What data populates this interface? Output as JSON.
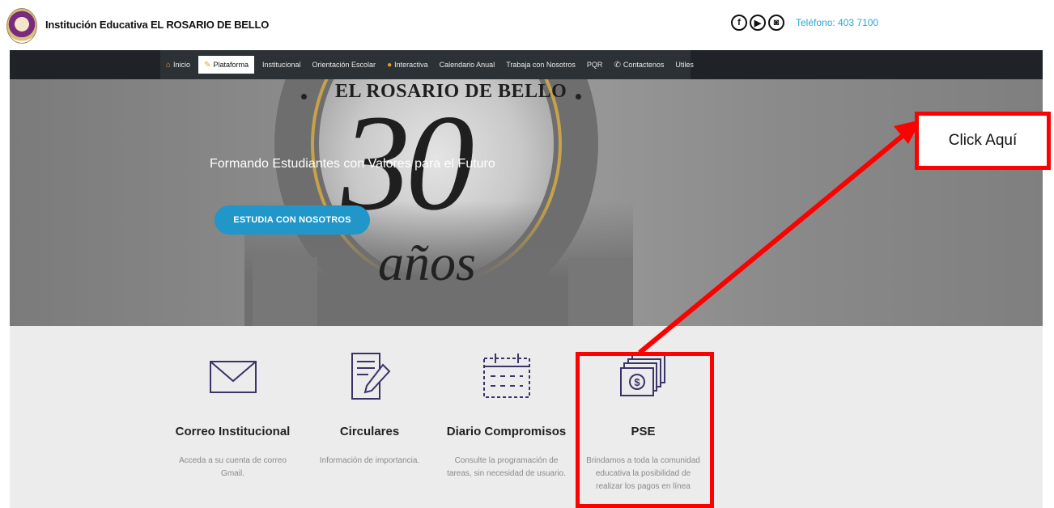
{
  "header": {
    "site_title": "Institución Educativa EL ROSARIO DE BELLO",
    "phone": "Teléfono: 403 7100",
    "social": [
      {
        "icon": "facebook-icon",
        "glyph": "f"
      },
      {
        "icon": "youtube-icon",
        "glyph": "▶"
      },
      {
        "icon": "instagram-icon",
        "glyph": "◙"
      }
    ]
  },
  "nav": {
    "items": [
      {
        "label": "Inicio",
        "icon": "home-icon"
      },
      {
        "label": "Plataforma",
        "icon": "pencil-icon",
        "active": true
      },
      {
        "label": "Institucional"
      },
      {
        "label": "Orientación Escolar"
      },
      {
        "label": "Interactiva",
        "icon": "lightbulb-icon"
      },
      {
        "label": "Calendario Anual"
      },
      {
        "label": "Trabaja con Nosotros"
      },
      {
        "label": "PQR"
      },
      {
        "label": "Contactenos",
        "icon": "phone-icon"
      },
      {
        "label": "Utiles"
      }
    ]
  },
  "hero": {
    "brand": "EL ROSARIO DE BELLO",
    "number": "30",
    "years": "años",
    "tagline": "Formando Estudiantes con Valores para el Futuro",
    "cta_label": "ESTUDIA CON NOSOTROS"
  },
  "services": [
    {
      "title": "Correo Institucional",
      "desc": "Acceda a su cuenta de correo Gmail.",
      "icon": "envelope-icon"
    },
    {
      "title": "Circulares",
      "desc": "Información de importancia.",
      "icon": "document-edit-icon"
    },
    {
      "title": "Diario Compromisos",
      "desc": "Consulte la programación de tareas, sin necesidad de usuario.",
      "icon": "calendar-icon"
    },
    {
      "title": "PSE",
      "desc": "Brindamos a toda la comunidad educativa la posibilidad de realizar los pagos en línea",
      "icon": "money-bills-icon"
    }
  ],
  "annotation": {
    "callout_text": "Click Aquí",
    "color": "#ff0000"
  },
  "colors": {
    "accent_blue": "#2196c8",
    "nav_dark": "#2c3135",
    "icon_purple": "#3a3468"
  }
}
